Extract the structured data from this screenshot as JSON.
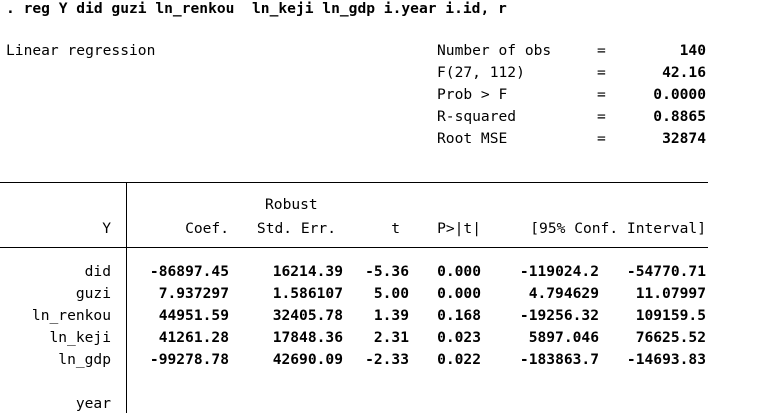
{
  "command": ". reg Y did guzi ln_renkou  ln_keji ln_gdp i.year i.id, r",
  "model_title": "Linear regression",
  "stats": [
    {
      "label": "Number of obs",
      "eq": "=",
      "value": "140"
    },
    {
      "label": "F(27, 112)",
      "eq": "=",
      "value": "42.16"
    },
    {
      "label": "Prob > F",
      "eq": "=",
      "value": "0.0000"
    },
    {
      "label": "R-squared",
      "eq": "=",
      "value": "0.8865"
    },
    {
      "label": "Root MSE",
      "eq": "=",
      "value": "32874"
    }
  ],
  "table": {
    "header_top": {
      "robust": "Robust"
    },
    "header": {
      "depvar": "Y",
      "coef": "Coef.",
      "se": "Std. Err.",
      "t": "t",
      "p": "P>|t|",
      "ci": "[95% Conf. Interval]"
    },
    "rows": [
      {
        "var": "did",
        "coef": "-86897.45",
        "se": "16214.39",
        "t": "-5.36",
        "p": "0.000",
        "lo": "-119024.2",
        "hi": "-54770.71"
      },
      {
        "var": "guzi",
        "coef": "7.937297",
        "se": "1.586107",
        "t": "5.00",
        "p": "0.000",
        "lo": "4.794629",
        "hi": "11.07997"
      },
      {
        "var": "ln_renkou",
        "coef": "44951.59",
        "se": "32405.78",
        "t": "1.39",
        "p": "0.168",
        "lo": "-19256.32",
        "hi": "109159.5"
      },
      {
        "var": "ln_keji",
        "coef": "41261.28",
        "se": "17848.36",
        "t": "2.31",
        "p": "0.023",
        "lo": "5897.046",
        "hi": "76625.52"
      },
      {
        "var": "ln_gdp",
        "coef": "-99278.78",
        "se": "42690.09",
        "t": "-2.33",
        "p": "0.022",
        "lo": "-183863.7",
        "hi": "-14693.83"
      }
    ],
    "trailing_var": "year"
  }
}
